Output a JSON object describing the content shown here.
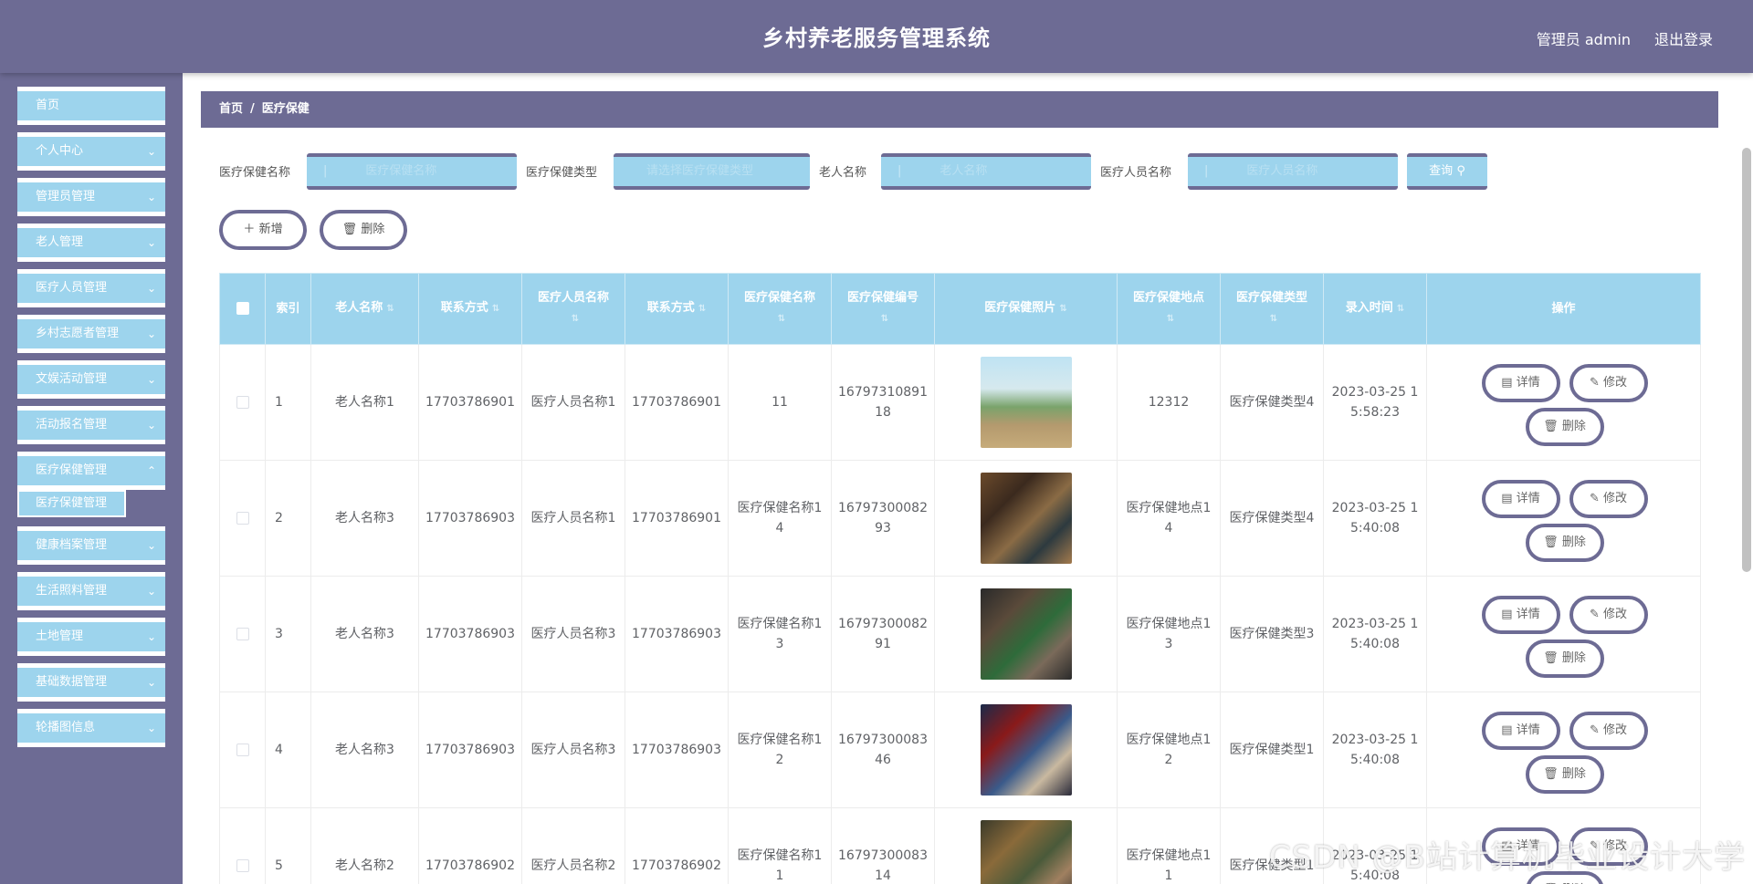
{
  "header": {
    "title": "乡村养老服务管理系统",
    "user": "管理员 admin",
    "logout": "退出登录"
  },
  "sidebar": {
    "items": [
      {
        "label": "首页",
        "arrow": false
      },
      {
        "label": "个人中心",
        "arrow": true
      },
      {
        "label": "管理员管理",
        "arrow": true
      },
      {
        "label": "老人管理",
        "arrow": true
      },
      {
        "label": "医疗人员管理",
        "arrow": true
      },
      {
        "label": "乡村志愿者管理",
        "arrow": true
      },
      {
        "label": "文娱活动管理",
        "arrow": true
      },
      {
        "label": "活动报名管理",
        "arrow": true
      },
      {
        "label": "医疗保健管理",
        "arrow": true
      },
      {
        "label": "健康档案管理",
        "arrow": true
      },
      {
        "label": "生活照料管理",
        "arrow": true
      },
      {
        "label": "土地管理",
        "arrow": true
      },
      {
        "label": "基础数据管理",
        "arrow": true
      },
      {
        "label": "轮播图信息",
        "arrow": true
      }
    ],
    "sub_active": "医疗保健管理"
  },
  "breadcrumb": {
    "home": "首页",
    "sep": "/",
    "current": "医疗保健"
  },
  "search": {
    "fields": [
      {
        "label": "医疗保健名称",
        "placeholder": "医疗保健名称"
      },
      {
        "label": "医疗保健类型",
        "placeholder": "请选择医疗保健类型"
      },
      {
        "label": "老人名称",
        "placeholder": "老人名称"
      },
      {
        "label": "医疗人员名称",
        "placeholder": "医疗人员名称"
      }
    ],
    "button": "查询"
  },
  "actions": {
    "add": "新增",
    "delete": "删除"
  },
  "table": {
    "headers": [
      "索引",
      "老人名称",
      "联系方式",
      "医疗人员名称",
      "联系方式",
      "医疗保健名称",
      "医疗保健编号",
      "医疗保健照片",
      "医疗保健地点",
      "医疗保健类型",
      "录入时间",
      "操作"
    ],
    "rows": [
      {
        "index": "1",
        "elder": "老人名称1",
        "phone": "17703786901",
        "staff": "医疗人员名称1",
        "staff_phone": "17703786901",
        "name": "11",
        "code": "1679731089118",
        "location": "12312",
        "type": "医疗保健类型4",
        "time": "2023-03-25 15:58:23"
      },
      {
        "index": "2",
        "elder": "老人名称3",
        "phone": "17703786903",
        "staff": "医疗人员名称1",
        "staff_phone": "17703786901",
        "name": "医疗保健名称14",
        "code": "1679730008293",
        "location": "医疗保健地点14",
        "type": "医疗保健类型4",
        "time": "2023-03-25 15:40:08"
      },
      {
        "index": "3",
        "elder": "老人名称3",
        "phone": "17703786903",
        "staff": "医疗人员名称3",
        "staff_phone": "17703786903",
        "name": "医疗保健名称13",
        "code": "1679730008291",
        "location": "医疗保健地点13",
        "type": "医疗保健类型3",
        "time": "2023-03-25 15:40:08"
      },
      {
        "index": "4",
        "elder": "老人名称3",
        "phone": "17703786903",
        "staff": "医疗人员名称3",
        "staff_phone": "17703786903",
        "name": "医疗保健名称12",
        "code": "1679730008346",
        "location": "医疗保健地点12",
        "type": "医疗保健类型1",
        "time": "2023-03-25 15:40:08"
      },
      {
        "index": "5",
        "elder": "老人名称2",
        "phone": "17703786902",
        "staff": "医疗人员名称2",
        "staff_phone": "17703786902",
        "name": "医疗保健名称11",
        "code": "1679730008314",
        "location": "医疗保健地点11",
        "type": "医疗保健类型1",
        "time": "2023-03-25 15:40:08"
      }
    ],
    "ops": {
      "detail": "详情",
      "edit": "修改",
      "delete": "删除"
    }
  },
  "watermark": "CSDN @B站计算机毕业设计大学",
  "colors": {
    "header": "#6d6b94",
    "accent": "#9dd4ed",
    "white": "#ffffff"
  },
  "icons": {
    "add": "plus-icon",
    "delete": "trash-icon",
    "search": "search-icon",
    "detail": "document-icon",
    "edit": "pencil-icon",
    "chevron": "chevron-down-icon"
  }
}
